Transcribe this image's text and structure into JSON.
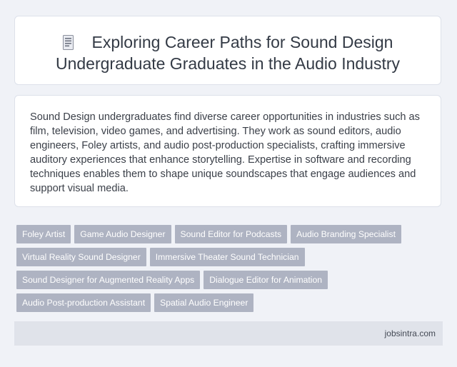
{
  "header": {
    "icon": "document-icon",
    "title_line1": "Exploring Career Paths for Sound Design",
    "title_line2": "Undergraduate Graduates in the Audio Industry"
  },
  "description": "Sound Design undergraduates find diverse career opportunities in industries such as film, television, video games, and advertising. They work as sound editors, audio engineers, Foley artists, and audio post-production specialists, crafting immersive auditory experiences that enhance storytelling. Expertise in software and recording techniques enables them to shape unique soundscapes that engage audiences and support visual media.",
  "tags": [
    [
      "Foley Artist",
      "Game Audio Designer",
      "Sound Editor for Podcasts",
      "Audio Branding Specialist"
    ],
    [
      "Virtual Reality Sound Designer",
      "Immersive Theater Sound Technician"
    ],
    [
      "Sound Designer for Augmented Reality Apps",
      "Dialogue Editor for Animation"
    ],
    [
      "Audio Post-production Assistant",
      "Spatial Audio Engineer"
    ]
  ],
  "footer": {
    "site": "jobsintra.com"
  },
  "colors": {
    "background": "#f0f2f7",
    "tag_background": "#aeb3c2",
    "tag_text": "#ffffff",
    "footer_background": "#e0e3ea"
  }
}
